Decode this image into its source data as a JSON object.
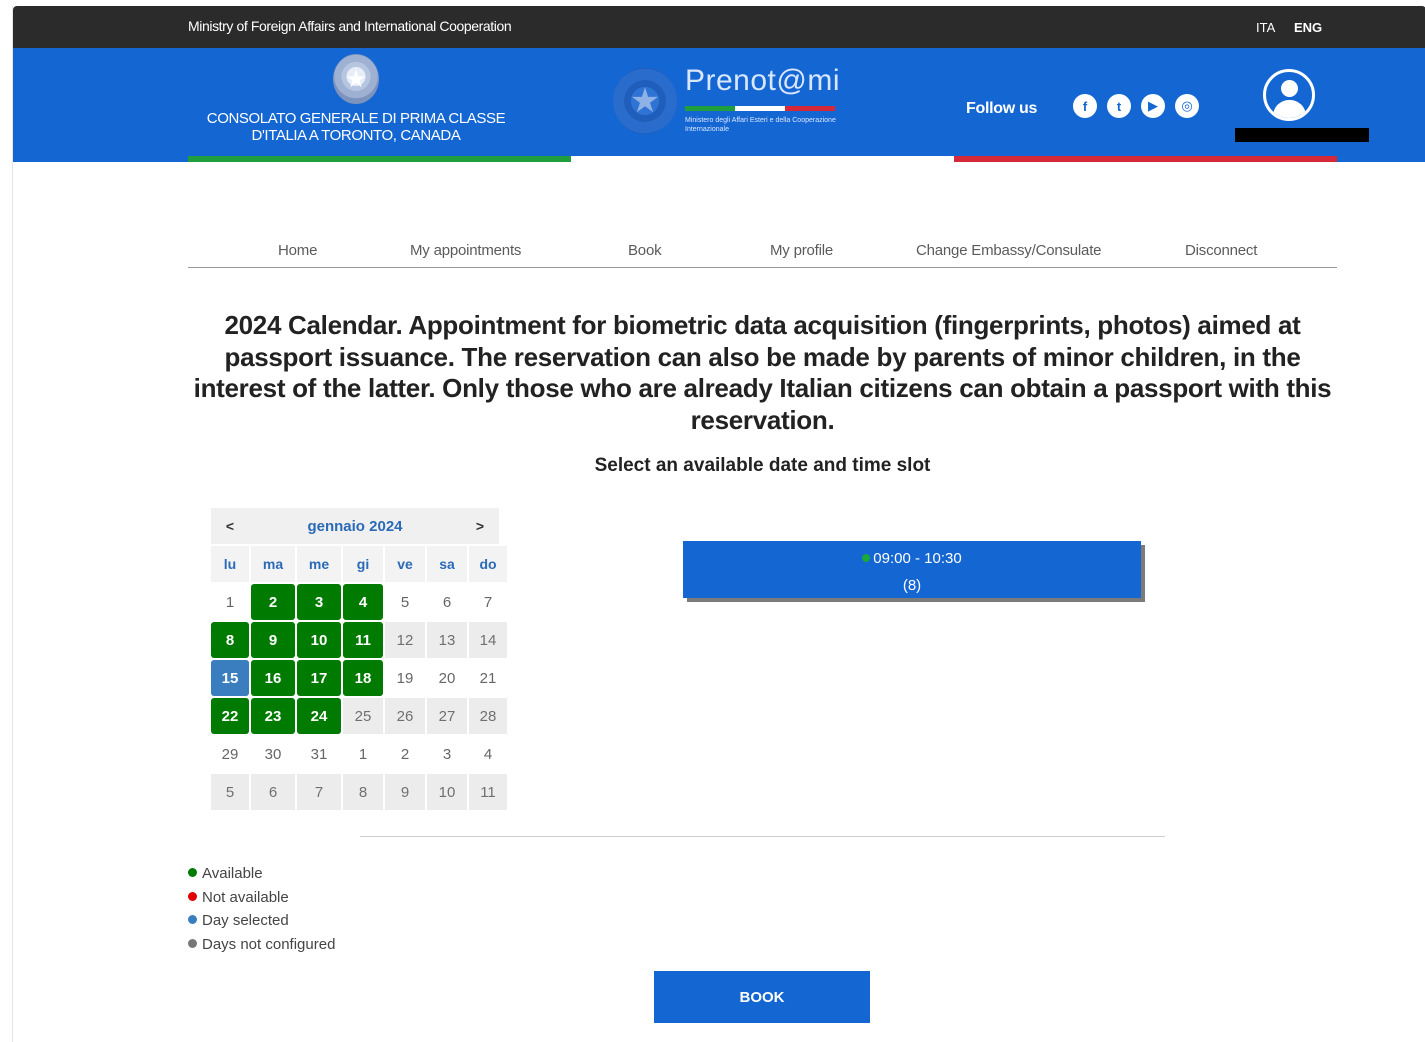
{
  "topbar": {
    "ministry": "Ministry of Foreign Affairs and International Cooperation",
    "lang_ita": "ITA",
    "lang_eng": "ENG"
  },
  "header": {
    "consulate": "CONSOLATO GENERALE DI PRIMA CLASSE D'ITALIA A TORONTO, CANADA",
    "logo_text": "Prenot@mi",
    "logo_sub": "Ministero degli Affari Esteri e della Cooperazione Internazionale",
    "follow_us": "Follow us",
    "social": [
      "facebook-icon",
      "twitter-icon",
      "youtube-icon",
      "instagram-icon"
    ]
  },
  "nav": [
    {
      "label": "Home"
    },
    {
      "label": "My appointments"
    },
    {
      "label": "Book"
    },
    {
      "label": "My profile"
    },
    {
      "label": "Change Embassy/Consulate"
    },
    {
      "label": "Disconnect"
    }
  ],
  "page": {
    "title": "2024 Calendar. Appointment for biometric data acquisition (fingerprints, photos) aimed at passport issuance. The reservation can also be made by parents of minor children, in the interest of the latter. Only those who are already Italian citizens can obtain a passport with this reservation.",
    "subtitle": "Select an available date and time slot"
  },
  "calendar": {
    "prev": "<",
    "next": ">",
    "month": "gennaio 2024",
    "weekdays": [
      "lu",
      "ma",
      "me",
      "gi",
      "ve",
      "sa",
      "do"
    ],
    "weeks": [
      [
        {
          "d": "1",
          "s": "plain"
        },
        {
          "d": "2",
          "s": "avail"
        },
        {
          "d": "3",
          "s": "avail"
        },
        {
          "d": "4",
          "s": "avail"
        },
        {
          "d": "5",
          "s": "plain"
        },
        {
          "d": "6",
          "s": "plain"
        },
        {
          "d": "7",
          "s": "plain"
        }
      ],
      [
        {
          "d": "8",
          "s": "avail"
        },
        {
          "d": "9",
          "s": "avail"
        },
        {
          "d": "10",
          "s": "avail"
        },
        {
          "d": "11",
          "s": "avail"
        },
        {
          "d": "12",
          "s": "grey"
        },
        {
          "d": "13",
          "s": "grey"
        },
        {
          "d": "14",
          "s": "grey"
        }
      ],
      [
        {
          "d": "15",
          "s": "selected"
        },
        {
          "d": "16",
          "s": "avail"
        },
        {
          "d": "17",
          "s": "avail"
        },
        {
          "d": "18",
          "s": "avail"
        },
        {
          "d": "19",
          "s": "plain"
        },
        {
          "d": "20",
          "s": "plain"
        },
        {
          "d": "21",
          "s": "plain"
        }
      ],
      [
        {
          "d": "22",
          "s": "avail"
        },
        {
          "d": "23",
          "s": "avail"
        },
        {
          "d": "24",
          "s": "avail"
        },
        {
          "d": "25",
          "s": "grey"
        },
        {
          "d": "26",
          "s": "grey"
        },
        {
          "d": "27",
          "s": "grey"
        },
        {
          "d": "28",
          "s": "grey"
        }
      ],
      [
        {
          "d": "29",
          "s": "plain"
        },
        {
          "d": "30",
          "s": "plain"
        },
        {
          "d": "31",
          "s": "plain"
        },
        {
          "d": "1",
          "s": "plain"
        },
        {
          "d": "2",
          "s": "plain"
        },
        {
          "d": "3",
          "s": "plain"
        },
        {
          "d": "4",
          "s": "plain"
        }
      ],
      [
        {
          "d": "5",
          "s": "grey"
        },
        {
          "d": "6",
          "s": "grey"
        },
        {
          "d": "7",
          "s": "grey"
        },
        {
          "d": "8",
          "s": "grey"
        },
        {
          "d": "9",
          "s": "grey"
        },
        {
          "d": "10",
          "s": "grey"
        },
        {
          "d": "11",
          "s": "grey"
        }
      ]
    ]
  },
  "slot": {
    "time": "09:00 - 10:30",
    "count": "(8)",
    "dot_color": "#1aa83b"
  },
  "legend": [
    {
      "label": "Available",
      "color": "#007a00"
    },
    {
      "label": "Not available",
      "color": "#e00000"
    },
    {
      "label": "Day selected",
      "color": "#3a7ec0"
    },
    {
      "label": "Days not configured",
      "color": "#777777"
    }
  ],
  "book_button": "BOOK",
  "colors": {
    "brand_blue": "#1466d2",
    "available_green": "#007a00",
    "selected_blue": "#3a7ec0"
  }
}
